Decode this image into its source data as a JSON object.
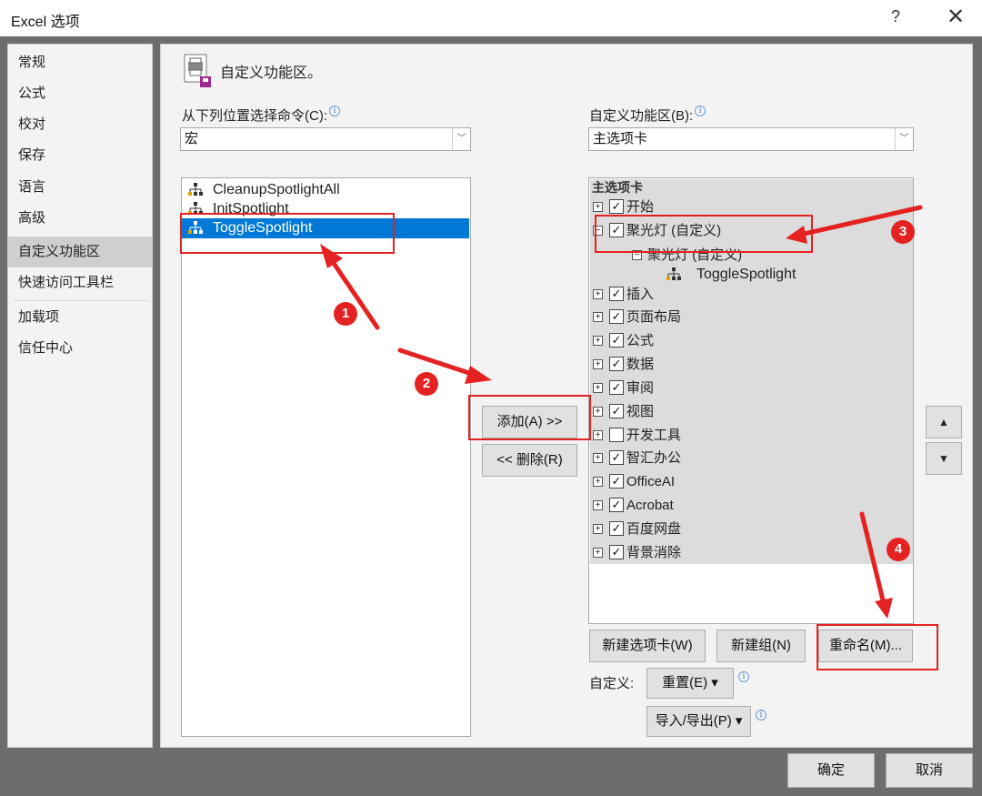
{
  "window": {
    "title": "Excel 选项",
    "help": "?",
    "close": "✕"
  },
  "sidebar": {
    "items": [
      "常规",
      "公式",
      "校对",
      "保存",
      "语言",
      "高级",
      "自定义功能区",
      "快速访问工具栏",
      "加载项",
      "信任中心"
    ],
    "active_index": 6
  },
  "header": {
    "title": "自定义功能区。"
  },
  "left": {
    "label": "从下列位置选择命令(C):",
    "combo_value": "宏",
    "items": [
      "CleanupSpotlightAll",
      "InitSpotlight",
      "ToggleSpotlight"
    ],
    "selected_index": 2
  },
  "right": {
    "label": "自定义功能区(B):",
    "combo_value": "主选项卡",
    "tree_header": "主选项卡",
    "tree": [
      {
        "label": "开始",
        "checked": true,
        "expander": "+"
      },
      {
        "label": "聚光灯 (自定义)",
        "checked": true,
        "expander": "−"
      },
      {
        "label": "聚光灯 (自定义)",
        "expander": "−",
        "level": 2
      },
      {
        "label": "ToggleSpotlight",
        "level": 3
      },
      {
        "label": "插入",
        "checked": true,
        "expander": "+"
      },
      {
        "label": "页面布局",
        "checked": true,
        "expander": "+"
      },
      {
        "label": "公式",
        "checked": true,
        "expander": "+"
      },
      {
        "label": "数据",
        "checked": true,
        "expander": "+"
      },
      {
        "label": "审阅",
        "checked": true,
        "expander": "+"
      },
      {
        "label": "视图",
        "checked": true,
        "expander": "+"
      },
      {
        "label": "开发工具",
        "checked": false,
        "expander": "+"
      },
      {
        "label": "智汇办公",
        "checked": true,
        "expander": "+"
      },
      {
        "label": "OfficeAI",
        "checked": true,
        "expander": "+"
      },
      {
        "label": "Acrobat",
        "checked": true,
        "expander": "+"
      },
      {
        "label": "百度网盘",
        "checked": true,
        "expander": "+"
      },
      {
        "label": "背景消除",
        "checked": true,
        "expander": "+"
      }
    ]
  },
  "buttons": {
    "add": "添加(A) >>",
    "remove": "<< 删除(R)",
    "new_tab": "新建选项卡(W)",
    "new_group": "新建组(N)",
    "rename": "重命名(M)...",
    "customize_label": "自定义:",
    "reset": "重置(E) ▾",
    "import_export": "导入/导出(P) ▾",
    "move_up": "▲",
    "move_down": "▼",
    "ok": "确定",
    "cancel": "取消"
  },
  "annotations": {
    "badges": [
      "1",
      "2",
      "3",
      "4"
    ],
    "color": "#e52222"
  },
  "colors": {
    "selection": "#0078d7",
    "panel": "#f3f3f3",
    "backdrop": "#6d6d6d"
  }
}
